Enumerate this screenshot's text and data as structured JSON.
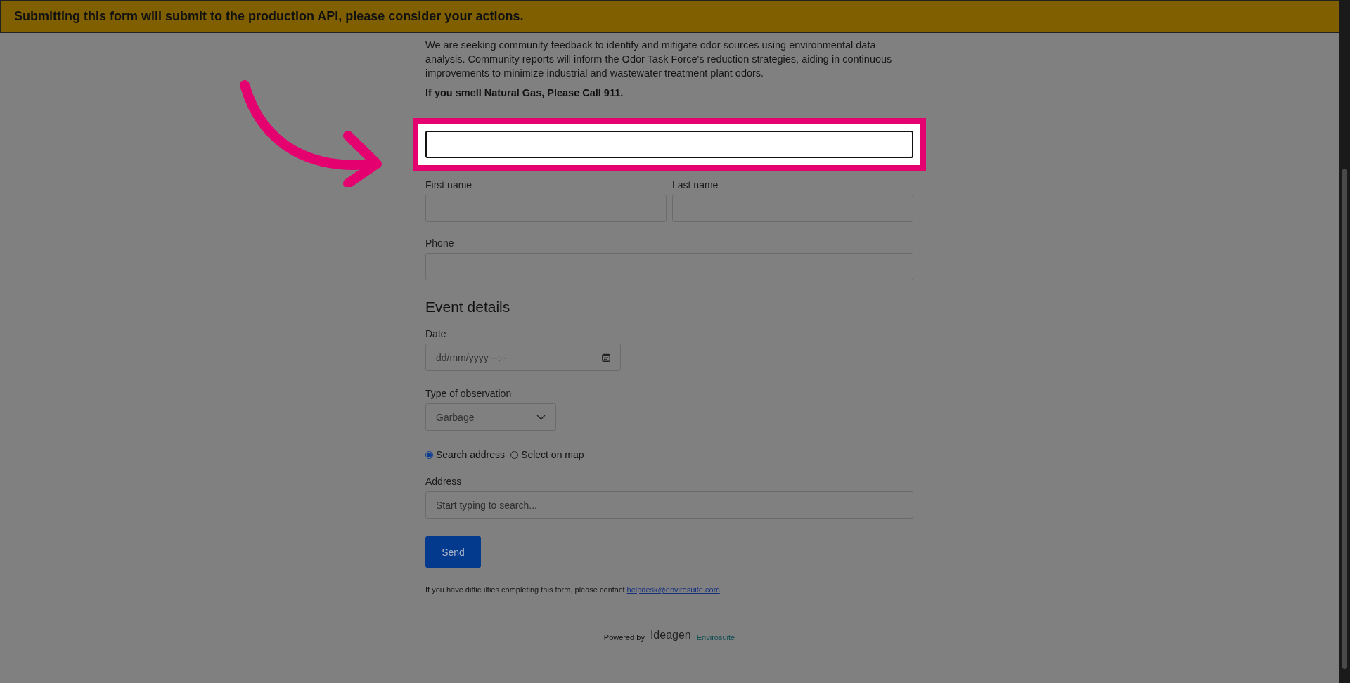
{
  "banner": {
    "text": "Submitting this form will submit to the production API, please consider your actions."
  },
  "intro": "We are seeking community feedback to identify and mitigate odor sources using environmental data analysis. Community reports will inform the Odor Task Force's reduction strategies, aiding in continuous improvements to minimize industrial and wastewater treatment plant odors.",
  "warning": "If you smell Natural Gas, Please Call 911.",
  "email_field": {
    "highlighted": true,
    "focused": true
  },
  "name_fields": [
    {
      "label": "First name"
    },
    {
      "label": "Last name"
    }
  ],
  "phone_field": {
    "label": "Phone"
  },
  "section_title": "Event details",
  "date_field": {
    "label": "Date",
    "placeholder": "dd/mm/yyyy --:--"
  },
  "observation_field": {
    "label": "Type of observation",
    "value": "Garbage"
  },
  "location_options": [
    {
      "label": "Search address",
      "selected": true
    },
    {
      "label": "Select on map",
      "selected": false
    }
  ],
  "address_field": {
    "label": "Address",
    "placeholder": "Start typing to search..."
  },
  "send_button": "Send",
  "help": {
    "text": "If you have difficulties completing this form, please contact",
    "link": "helpdesk@envirosuite.com"
  },
  "footer": {
    "powered_by": "Powered by",
    "logo_primary": "Ideagen",
    "logo_secondary": "Envirosuite"
  }
}
